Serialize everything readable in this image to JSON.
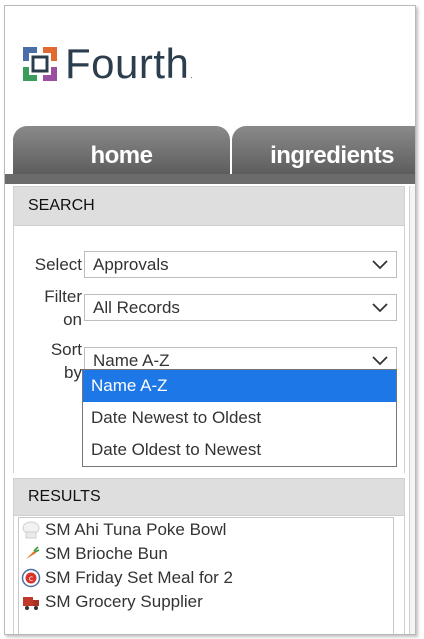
{
  "brand": {
    "name": "Fourth",
    "tm": "."
  },
  "tabs": [
    {
      "label": "home"
    },
    {
      "label": "ingredients"
    }
  ],
  "search": {
    "title": "SEARCH",
    "select": {
      "label": "Select",
      "value": "Approvals"
    },
    "filter": {
      "label_line1": "Filter",
      "label_line2": "on",
      "value": "All Records"
    },
    "sort": {
      "label_line1": "Sort",
      "label_line2": "by",
      "value": "Name A-Z",
      "options": [
        "Name A-Z",
        "Date Newest to Oldest",
        "Date Oldest to Newest"
      ]
    }
  },
  "results": {
    "title": "RESULTS",
    "items": [
      {
        "label": "SM Ahi Tuna Poke Bowl",
        "icon": "chef-hat-icon"
      },
      {
        "label": "SM Brioche Bun",
        "icon": "carrot-icon"
      },
      {
        "label": "SM Friday Set Meal for 2",
        "icon": "set-meal-icon"
      },
      {
        "label": "SM Grocery Supplier",
        "icon": "supplier-truck-icon"
      }
    ]
  },
  "colors": {
    "accent": "#1e77e6",
    "tab": "#6b6b6b",
    "panel_header": "#dedede",
    "logo": "#2c3d4d"
  }
}
